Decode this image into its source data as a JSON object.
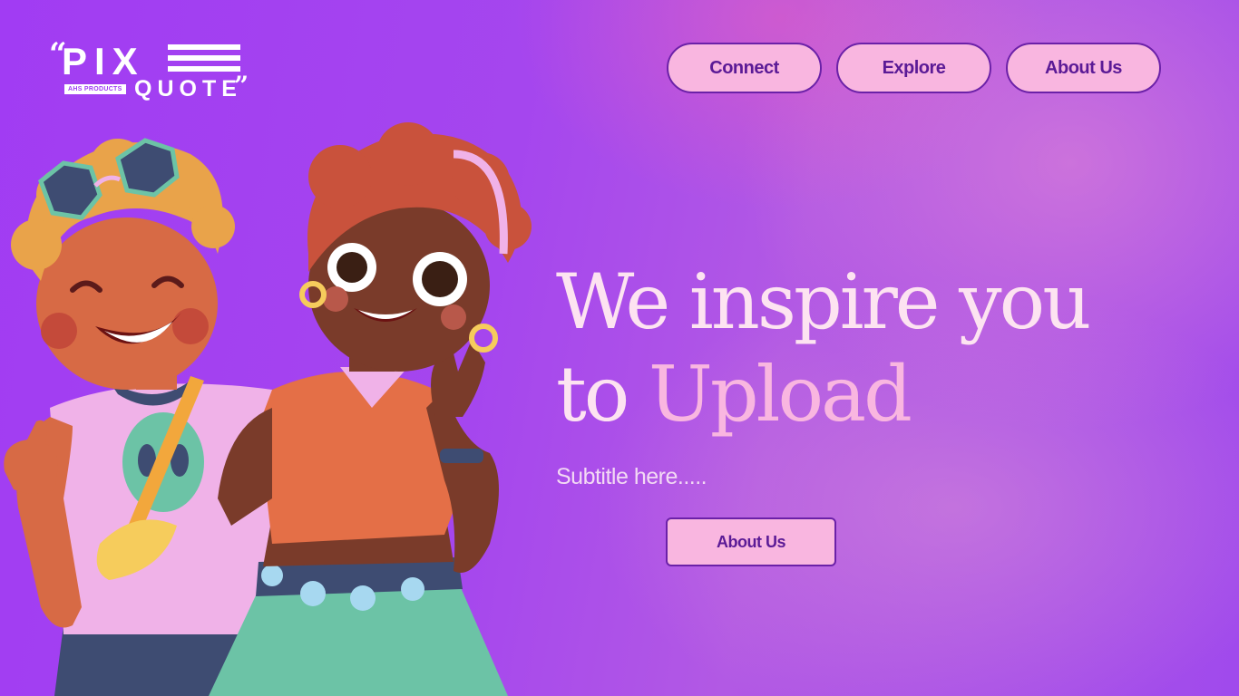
{
  "logo": {
    "quote_open": "“",
    "pix": "PIX",
    "badge": "AHS PRODUCTS",
    "quote": "QUOTE",
    "quote_close": "”"
  },
  "nav": {
    "items": [
      {
        "label": "Connect"
      },
      {
        "label": "Explore"
      },
      {
        "label": "About Us"
      }
    ]
  },
  "hero": {
    "line1": "We inspire you",
    "line2_prefix": "to",
    "line2_accent": "Upload",
    "subtitle": "Subtitle here.....",
    "cta_label": "About Us"
  },
  "colors": {
    "background": "#a53df2",
    "button_fill": "#f9b6e0",
    "button_border": "#6b21a8",
    "button_text": "#5b1a96",
    "title_light": "#fde3f1",
    "title_accent": "#f9b6e0"
  },
  "illustration": {
    "icons": [
      "boy-character-illustration",
      "girl-character-illustration"
    ]
  }
}
